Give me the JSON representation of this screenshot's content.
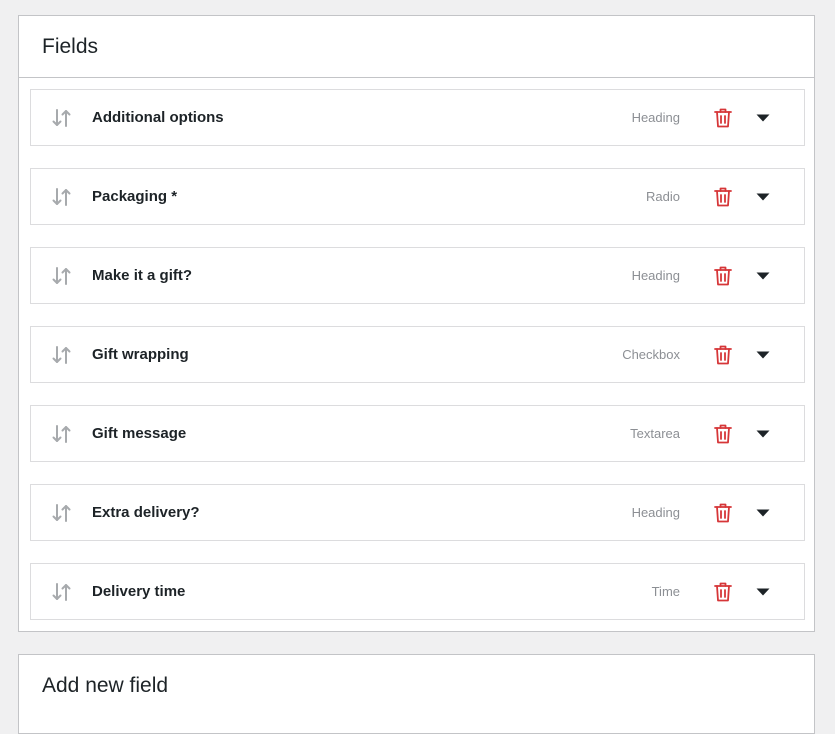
{
  "fields_panel": {
    "title": "Fields",
    "items": [
      {
        "label": "Additional options",
        "type": "Heading"
      },
      {
        "label": "Packaging *",
        "type": "Radio"
      },
      {
        "label": "Make it a gift?",
        "type": "Heading"
      },
      {
        "label": "Gift wrapping",
        "type": "Checkbox"
      },
      {
        "label": "Gift message",
        "type": "Textarea"
      },
      {
        "label": "Extra delivery?",
        "type": "Heading"
      },
      {
        "label": "Delivery time",
        "type": "Time"
      }
    ]
  },
  "add_panel": {
    "title": "Add new field"
  },
  "icons": {
    "drag": "sort-arrows-icon",
    "delete": "trash-icon",
    "toggle": "caret-down-icon"
  },
  "colors": {
    "delete": "#d63638",
    "drag": "#a7aaad",
    "type_text": "#8c8f94",
    "caret": "#1d2327"
  }
}
